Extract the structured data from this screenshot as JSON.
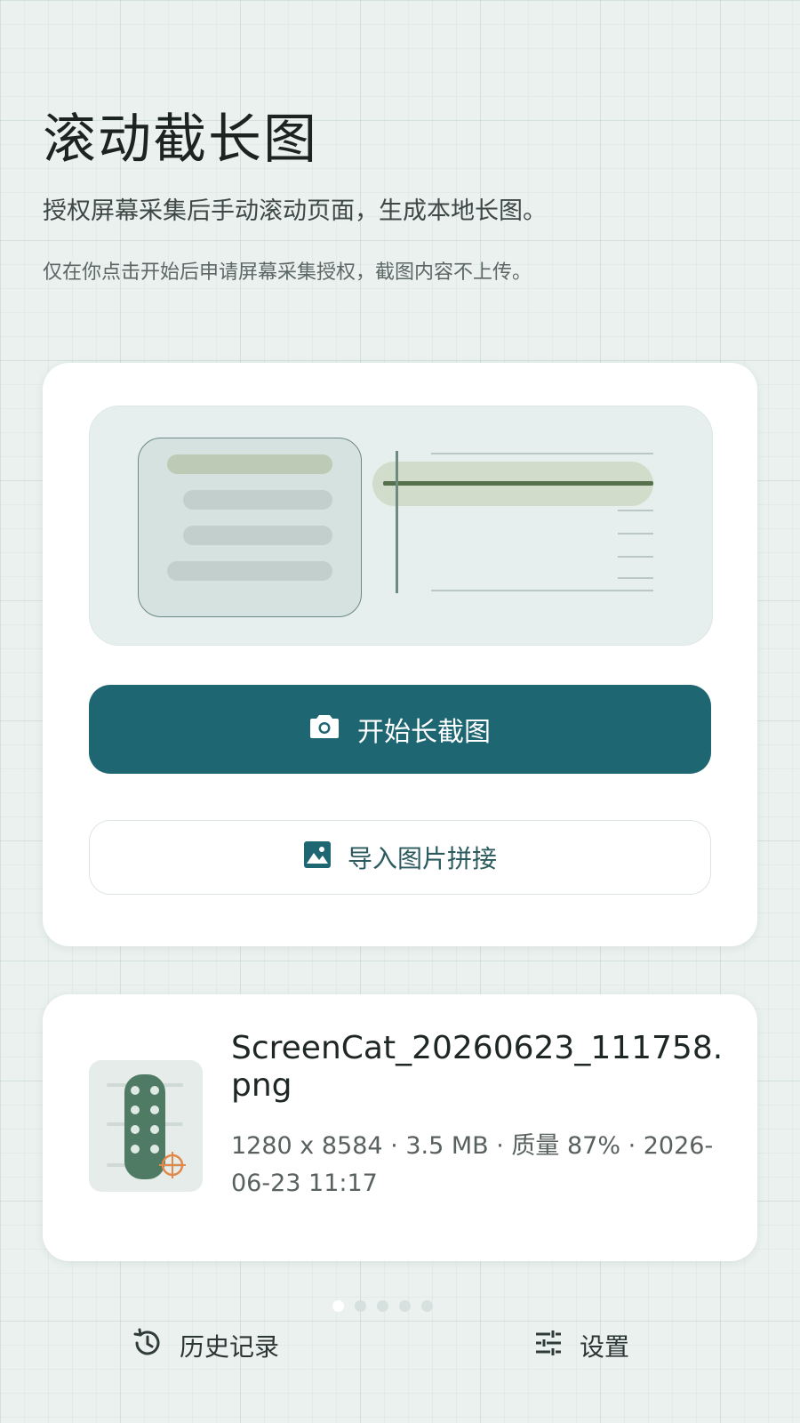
{
  "header": {
    "title": "滚动截长图",
    "subtitle": "授权屏幕采集后手动滚动页面，生成本地长图。",
    "note": "仅在你点击开始后申请屏幕采集授权，截图内容不上传。"
  },
  "main_card": {
    "primary_button": {
      "label": "开始长截图",
      "icon": "camera-icon"
    },
    "secondary_button": {
      "label": "导入图片拼接",
      "icon": "image-icon"
    }
  },
  "recent_file": {
    "name": "ScreenCat_20260623_111758.png",
    "meta": "1280 x 8584 · 3.5 MB · 质量 87% · 2026-06-23 11:17"
  },
  "pager": {
    "count": 5,
    "active_index": 0
  },
  "bottom_nav": {
    "history": {
      "label": "历史记录",
      "icon": "history-icon"
    },
    "settings": {
      "label": "设置",
      "icon": "sliders-icon"
    }
  },
  "colors": {
    "accent": "#1e6672",
    "background": "#eaf1ef",
    "card": "#ffffff"
  }
}
